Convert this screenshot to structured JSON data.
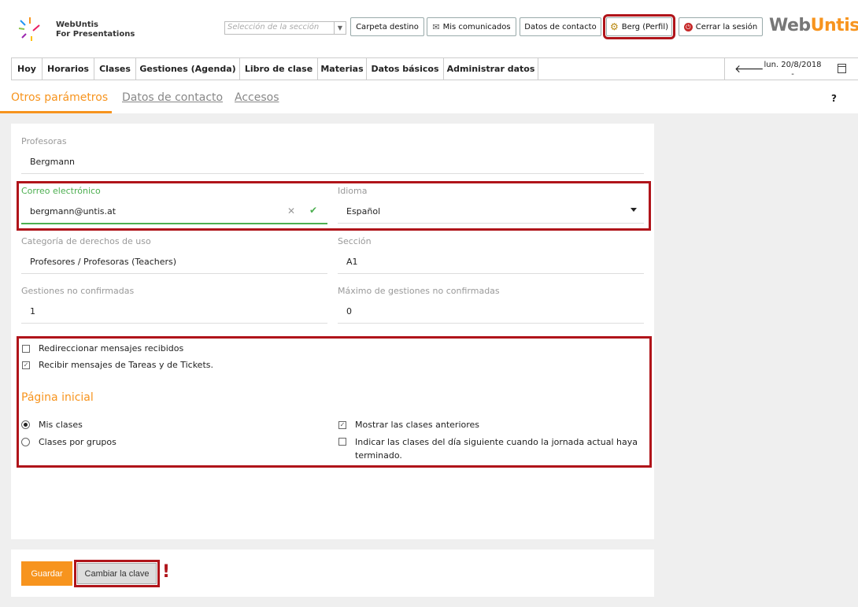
{
  "header": {
    "logo_line1": "WebUntis",
    "logo_line2": "For Presentations",
    "section_placeholder": "Selección de la sección",
    "buttons": {
      "folder": "Carpeta destino",
      "messages": "Mis comunicados",
      "contact": "Datos de contacto",
      "profile": "Berg (Perfil)",
      "logout": "Cerrar la sesión"
    },
    "brand_a": "Web",
    "brand_b": "Untis"
  },
  "nav": {
    "items": [
      "Hoy",
      "Horarios",
      "Clases",
      "Gestiones (Agenda)",
      "Libro de clase",
      "Materias",
      "Datos básicos",
      "Administrar datos"
    ],
    "date": "lun. 20/8/2018",
    "date_sub": "-"
  },
  "subtabs": {
    "other": "Otros parámetros",
    "contact": "Datos de contacto",
    "access": "Accesos",
    "help": "?"
  },
  "form": {
    "teachers_label": "Profesoras",
    "teachers_value": "Bergmann",
    "email_label": "Correo electrónico",
    "email_value": "bergmann@untis.at",
    "language_label": "Idioma",
    "language_value": "Español",
    "rights_label": "Categoría de derechos de uso",
    "rights_value": "Profesores / Profesoras (Teachers)",
    "section_label": "Sección",
    "section_value": "A1",
    "unconfirmed_label": "Gestiones no confirmadas",
    "unconfirmed_value": "1",
    "max_unconfirmed_label": "Máximo de gestiones no confirmadas",
    "max_unconfirmed_value": "0"
  },
  "options": {
    "redirect": "Redireccionar mensajes recibidos",
    "receive_tasks": "Recibir mensajes de Tareas y de Tickets.",
    "start_page_title": "Página inicial",
    "my_classes": "Mis clases",
    "classes_by_group": "Clases por grupos",
    "show_previous": "Mostrar las clases anteriores",
    "next_day_line1": "Indicar las clases del día siguiente cuando la jornada actual haya",
    "next_day_line2": "terminado."
  },
  "actions": {
    "save": "Guardar",
    "change_password": "Cambiar la clave",
    "mark": "!"
  },
  "colors": {
    "accent": "#f7941e",
    "highlight": "#b0141a",
    "valid": "#4caf50"
  }
}
